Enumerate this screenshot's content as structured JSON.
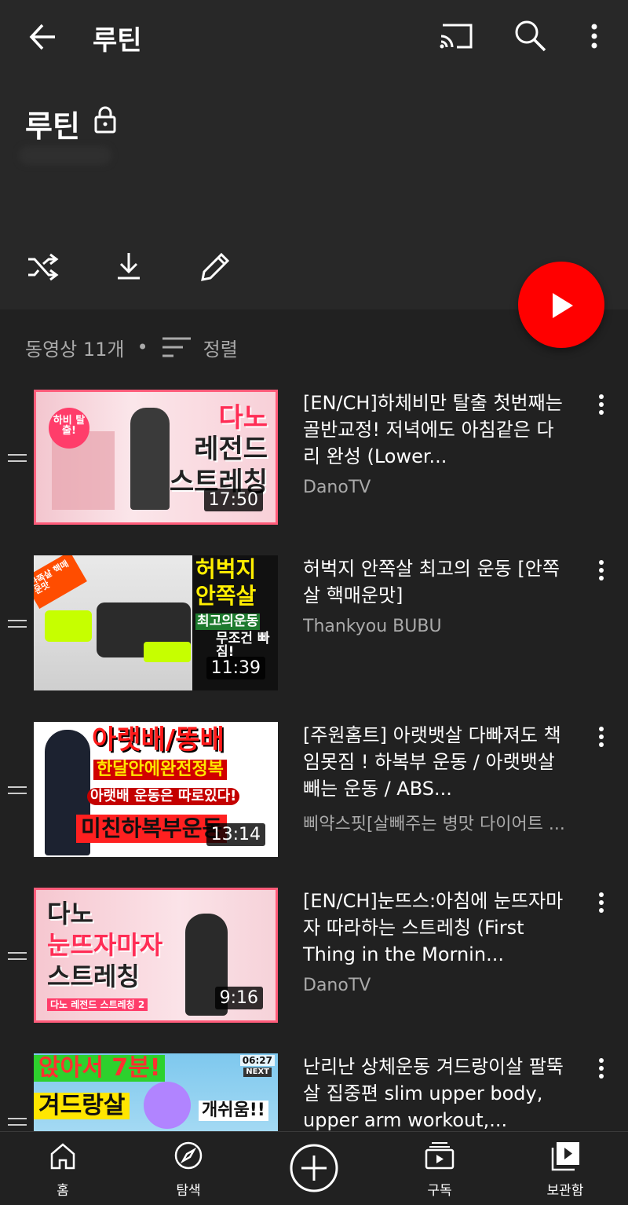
{
  "appbar": {
    "title": "루틴"
  },
  "header": {
    "title": "루틴"
  },
  "list": {
    "count_label": "동영상 11개",
    "separator": "•",
    "sort_label": "정렬"
  },
  "videos": [
    {
      "title": "[EN/CH]하체비만 탈출 첫번째는 골반교정! 저녁에도 아침같은 다리 완성 (Lower...",
      "channel": "DanoTV",
      "duration": "17:50",
      "thumb_text": [
        "다노",
        "레전드",
        "스트레칭"
      ],
      "badge": "하비 탈출!"
    },
    {
      "title": "허벅지 안쪽살 최고의 운동 [안쪽살 핵매운맛]",
      "channel": "Thankyou BUBU",
      "duration": "11:39",
      "thumb_text": [
        "허벅지",
        "안쪽살",
        "최고의운동",
        "무조건 빠짐!"
      ],
      "badge": "안쪽살 핵매운맛"
    },
    {
      "title": "[주원홈트] 아랫뱃살 다빠져도 책임못짐 ! 하복부 운동 / 아랫뱃살 빼는 운동 / ABS...",
      "channel": "삐약스핏[살빼주는 병맛 다이어트 ...",
      "duration": "13:14",
      "thumb_text": [
        "아랫배/똥배",
        "한달안에완전정복",
        "아랫배 운동은 따로있다!",
        "미친하복부운동"
      ]
    },
    {
      "title": "[EN/CH]눈뜨스:아침에 눈뜨자마자 따라하는 스트레칭 (First Thing in the Mornin...",
      "channel": "DanoTV",
      "duration": "9:16",
      "thumb_text": [
        "다노",
        "눈뜨자마자",
        "스트레칭",
        "다노 레전드 스트레칭 2"
      ]
    },
    {
      "title": "난리난 상체운동 겨드랑이살 팔뚝살 집중편 slim upper body, upper arm workout,...",
      "channel": "",
      "duration": "",
      "thumb_text": [
        "앉아서 7분!",
        "겨드랑살",
        "개쉬움!!",
        "06:27",
        "NEXT"
      ]
    }
  ],
  "nav": [
    {
      "label": "홈",
      "icon": "home-icon"
    },
    {
      "label": "탐색",
      "icon": "explore-icon"
    },
    {
      "label": "",
      "icon": "create-icon"
    },
    {
      "label": "구독",
      "icon": "subscriptions-icon"
    },
    {
      "label": "보관함",
      "icon": "library-icon"
    }
  ],
  "colors": {
    "accent": "#ff0000",
    "background": "#212121",
    "surface": "#282828"
  }
}
